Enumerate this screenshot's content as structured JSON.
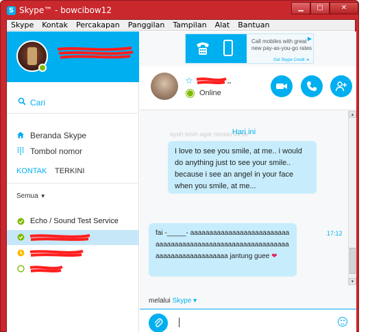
{
  "window": {
    "title": "Skype™ - bowcibow12",
    "logo": "skype-logo",
    "controls": [
      "minimize",
      "maximize",
      "close"
    ]
  },
  "menu": [
    "Skype",
    "Kontak",
    "Percakapan",
    "Panggilan",
    "Tampilan",
    "Alat",
    "Bantuan"
  ],
  "profile": {
    "status": "online",
    "status_color": "#7fba00"
  },
  "search": {
    "label": "Cari"
  },
  "nav": [
    {
      "label": "Beranda Skype",
      "icon": "home-icon"
    },
    {
      "label": "Tombol nomor",
      "icon": "dialpad-icon"
    }
  ],
  "tabs": {
    "active": "KONTAK",
    "inactive": "TERKINI"
  },
  "filter": {
    "label": "Semua"
  },
  "contacts": [
    {
      "name": "Echo / Sound Test Service",
      "status": "online",
      "selected": false
    },
    {
      "name": "",
      "status": "online",
      "selected": true
    },
    {
      "name": "",
      "status": "away",
      "selected": false
    },
    {
      "name": "",
      "status": "offline",
      "selected": false
    }
  ],
  "ad": {
    "text": "Call mobiles with great new pay-as-you-go rates",
    "link": "Get Skype Credit ➜"
  },
  "conversation": {
    "status": "Online",
    "date_separator": "Hari ini",
    "faded_text": "ayah lebih agar nesian ini de",
    "messages": [
      {
        "direction": "out",
        "text": "I love to see you smile, at me.. i would do anything just to see your smile.. because i see an angel in your face when you smile, at me..."
      },
      {
        "direction": "in",
        "text": "fai -_____- aaaaaaaaaaaaaaaaaaaaaaaaaaaaaaaaaaaaaaaaaaaaaaaaaaaaaaaaaaaaaaaaaaaaaaaaaaaaaaaa jantung guee",
        "emoji": "❤",
        "time": "17:12"
      }
    ],
    "via_prefix": "melalui",
    "via_service": "Skype ▾"
  },
  "colors": {
    "accent": "#00aff0",
    "window_frame": "#c9282d",
    "bubble": "#c7edfc",
    "selected_row": "#c6e7f7",
    "online": "#7fba00",
    "away": "#ffb900"
  }
}
